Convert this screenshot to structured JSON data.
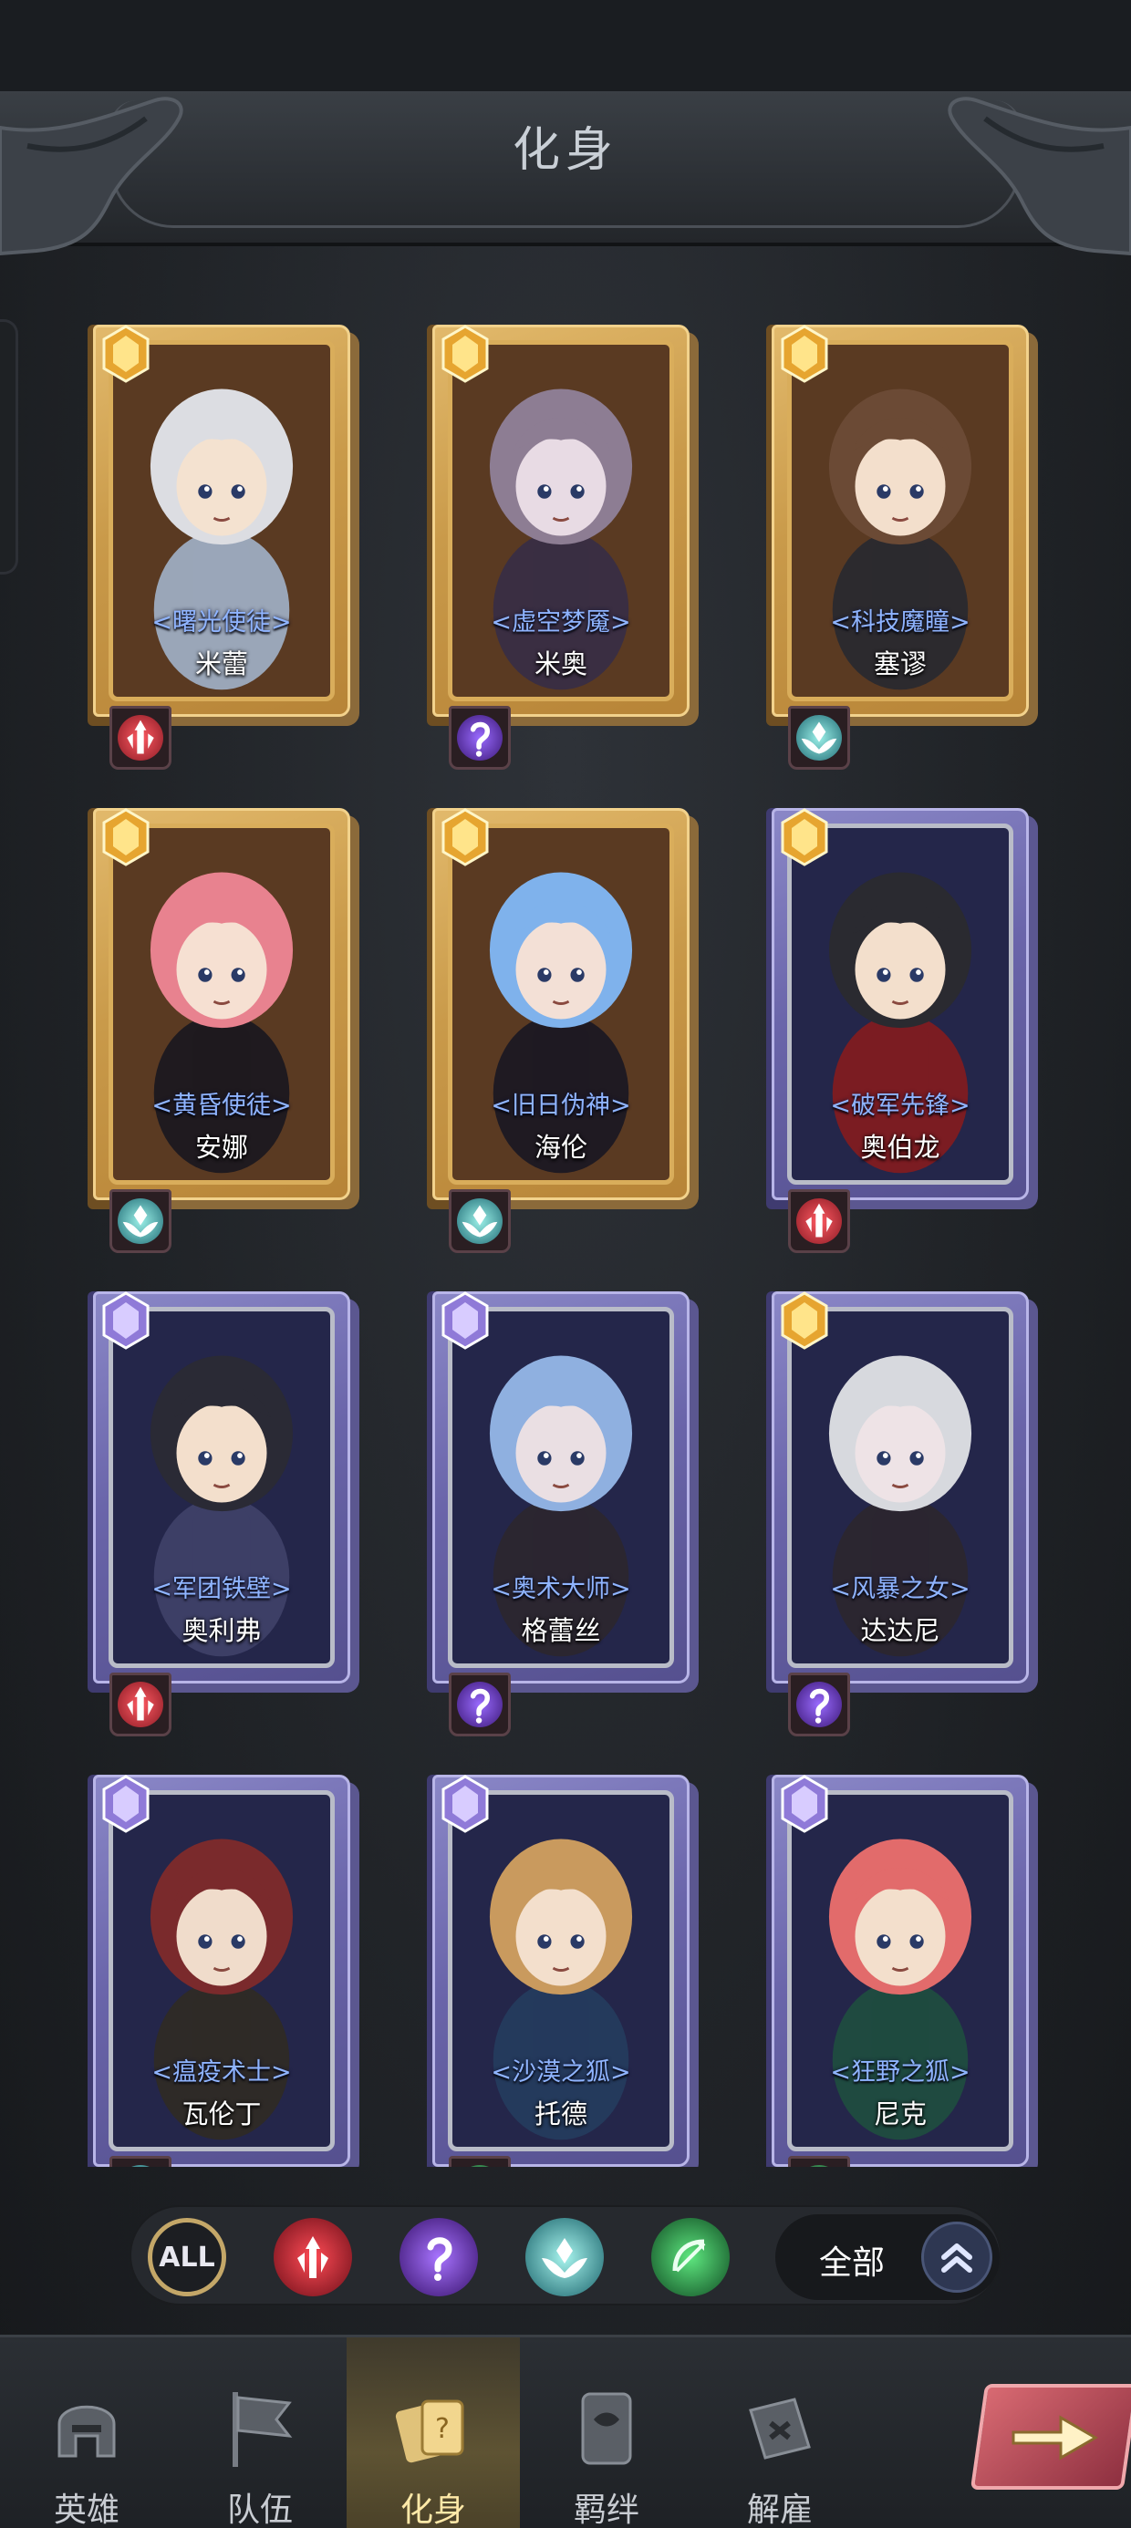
{
  "page_title": "化身",
  "cards": [
    {
      "title": "<曙光使徒>",
      "name": "米蕾",
      "frame": "gold",
      "rarity": "gold",
      "class": "warrior",
      "hair": "#dcdde2",
      "skin": "#f4e2d0",
      "outfit": "#9aa6b8"
    },
    {
      "title": "<虚空梦魇>",
      "name": "米奥",
      "frame": "gold",
      "rarity": "gold",
      "class": "mage",
      "hair": "#8d7d93",
      "skin": "#e8dbe4",
      "outfit": "#3a2e42"
    },
    {
      "title": "<科技魔瞳>",
      "name": "塞谬",
      "frame": "gold",
      "rarity": "gold",
      "class": "priest",
      "hair": "#6b4a35",
      "skin": "#f3dfcc",
      "outfit": "#2c2a2e"
    },
    {
      "title": "<黄昏使徒>",
      "name": "安娜",
      "frame": "gold",
      "rarity": "gold",
      "class": "priest",
      "hair": "#e8828f",
      "skin": "#f6e0d2",
      "outfit": "#1f1a1f"
    },
    {
      "title": "<旧日伪神>",
      "name": "海伦",
      "frame": "gold",
      "rarity": "gold",
      "class": "priest",
      "hair": "#7fb2ec",
      "skin": "#f3e0d6",
      "outfit": "#1f1a22"
    },
    {
      "title": "<破军先锋>",
      "name": "奥伯龙",
      "frame": "purple",
      "rarity": "gold",
      "class": "warrior",
      "hair": "#2a2a30",
      "skin": "#f3dfcc",
      "outfit": "#7b1c22"
    },
    {
      "title": "<军团铁壁>",
      "name": "奥利弗",
      "frame": "purple",
      "rarity": "purple",
      "class": "warrior",
      "hair": "#2a2a35",
      "skin": "#f3dfcc",
      "outfit": "#3d3f66"
    },
    {
      "title": "<奥术大师>",
      "name": "格蕾丝",
      "frame": "purple",
      "rarity": "purple",
      "class": "mage",
      "hair": "#8fb0e0",
      "skin": "#eadfe3",
      "outfit": "#2b2630"
    },
    {
      "title": "<风暴之女>",
      "name": "达达尼",
      "frame": "purple",
      "rarity": "gold",
      "class": "mage",
      "hair": "#d7d9de",
      "skin": "#eee3e6",
      "outfit": "#2b2630"
    },
    {
      "title": "<瘟疫术士>",
      "name": "瓦伦丁",
      "frame": "purple",
      "rarity": "purple",
      "class": "priest",
      "hair": "#7a2a2c",
      "skin": "#f0dccb",
      "outfit": "#2e2a27"
    },
    {
      "title": "<沙漠之狐>",
      "name": "托德",
      "frame": "purple",
      "rarity": "purple",
      "class": "ranger",
      "hair": "#c99a5e",
      "skin": "#f3dfcc",
      "outfit": "#243a5c"
    },
    {
      "title": "<狂野之狐>",
      "name": "尼克",
      "frame": "purple",
      "rarity": "purple",
      "class": "ranger",
      "hair": "#e26b6b",
      "skin": "#f3dfcc",
      "outfit": "#1f4a40"
    }
  ],
  "filters": {
    "all_label": "ALL",
    "sort_label": "全部",
    "icons": [
      "warrior-class-icon",
      "mage-class-icon",
      "priest-class-icon",
      "ranger-class-icon"
    ]
  },
  "nav": [
    {
      "label": "英雄",
      "icon": "helmet-icon",
      "active": false
    },
    {
      "label": "队伍",
      "icon": "banner-icon",
      "active": false
    },
    {
      "label": "化身",
      "icon": "cards-icon",
      "active": true
    },
    {
      "label": "羁绊",
      "icon": "scroll-icon",
      "active": false
    },
    {
      "label": "解雇",
      "icon": "dismiss-icon",
      "active": false
    }
  ],
  "colors": {
    "gold_frame": "#d9ad5b",
    "purple_frame": "#6a65aa",
    "title_blue": "#8fb4ff",
    "active_nav": "#5e5333"
  }
}
